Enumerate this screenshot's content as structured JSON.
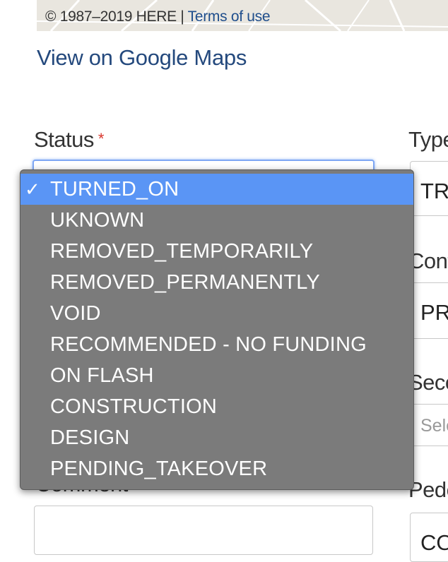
{
  "map": {
    "attribution": "© 1987–2019 HERE | ",
    "terms_link": "Terms of use"
  },
  "view_link": "View on Google Maps",
  "status": {
    "label": "Status",
    "required_mark": "*",
    "options": [
      "TURNED_ON",
      "UKNOWN",
      "REMOVED_TEMPORARILY",
      "REMOVED_PERMANENTLY",
      "VOID",
      "RECOMMENDED - NO FUNDING",
      "ON FLASH",
      "CONSTRUCTION",
      "DESIGN",
      "PENDING_TAKEOVER"
    ],
    "selected": "TURNED_ON"
  },
  "comment": {
    "label": "Comment"
  },
  "right_column": {
    "type_label": "Type",
    "type_value": "TRA",
    "control_label": "Cont",
    "control_value": "PRI",
    "secondary_label": "Seco",
    "secondary_placeholder": "Sele",
    "pedestrian_label": "Pede",
    "pedestrian_value": "CO"
  },
  "colors": {
    "link": "#24497d",
    "selected_option": "#5a95f5",
    "dropdown_bg": "#7b7b7b",
    "required": "#d9352c"
  }
}
